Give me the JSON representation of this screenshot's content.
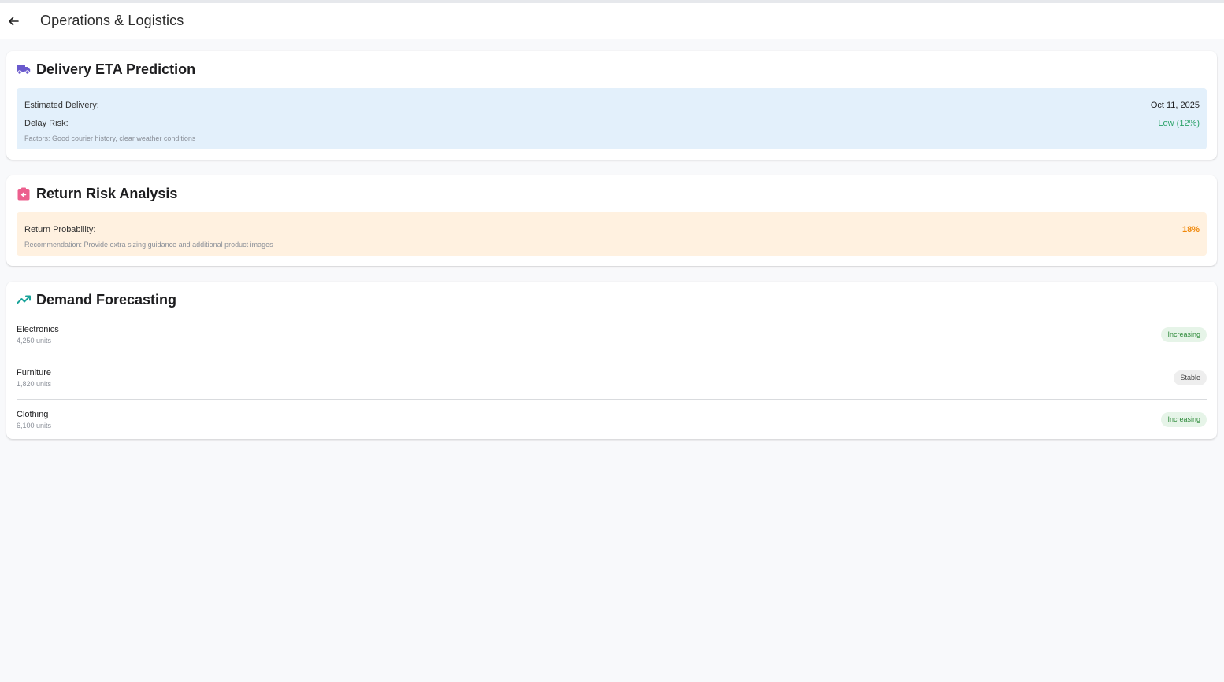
{
  "appbar": {
    "title": "Operations & Logistics"
  },
  "delivery": {
    "title": "Delivery ETA Prediction",
    "icon": "truck-icon",
    "estimated_label": "Estimated Delivery:",
    "estimated_value": "Oct 11, 2025",
    "delay_label": "Delay Risk:",
    "delay_value": "Low (12%)",
    "factors": "Factors: Good courier history, clear weather conditions"
  },
  "returns": {
    "title": "Return Risk Analysis",
    "icon": "return-box-icon",
    "probability_label": "Return Probability:",
    "probability_value": "18%",
    "recommendation": "Recommendation: Provide extra sizing guidance and additional product images"
  },
  "demand": {
    "title": "Demand Forecasting",
    "icon": "trending-up-icon",
    "items": [
      {
        "name": "Electronics",
        "units": "4,250 units",
        "trend": "Increasing"
      },
      {
        "name": "Furniture",
        "units": "1,820 units",
        "trend": "Stable"
      },
      {
        "name": "Clothing",
        "units": "6,100 units",
        "trend": "Increasing"
      }
    ]
  },
  "colors": {
    "accent_purple": "#6a5acd",
    "return_pink": "#ec5f8e",
    "trend_teal": "#1aa39a",
    "low_risk_green": "#2ea36b",
    "return_orange": "#f0880a"
  }
}
